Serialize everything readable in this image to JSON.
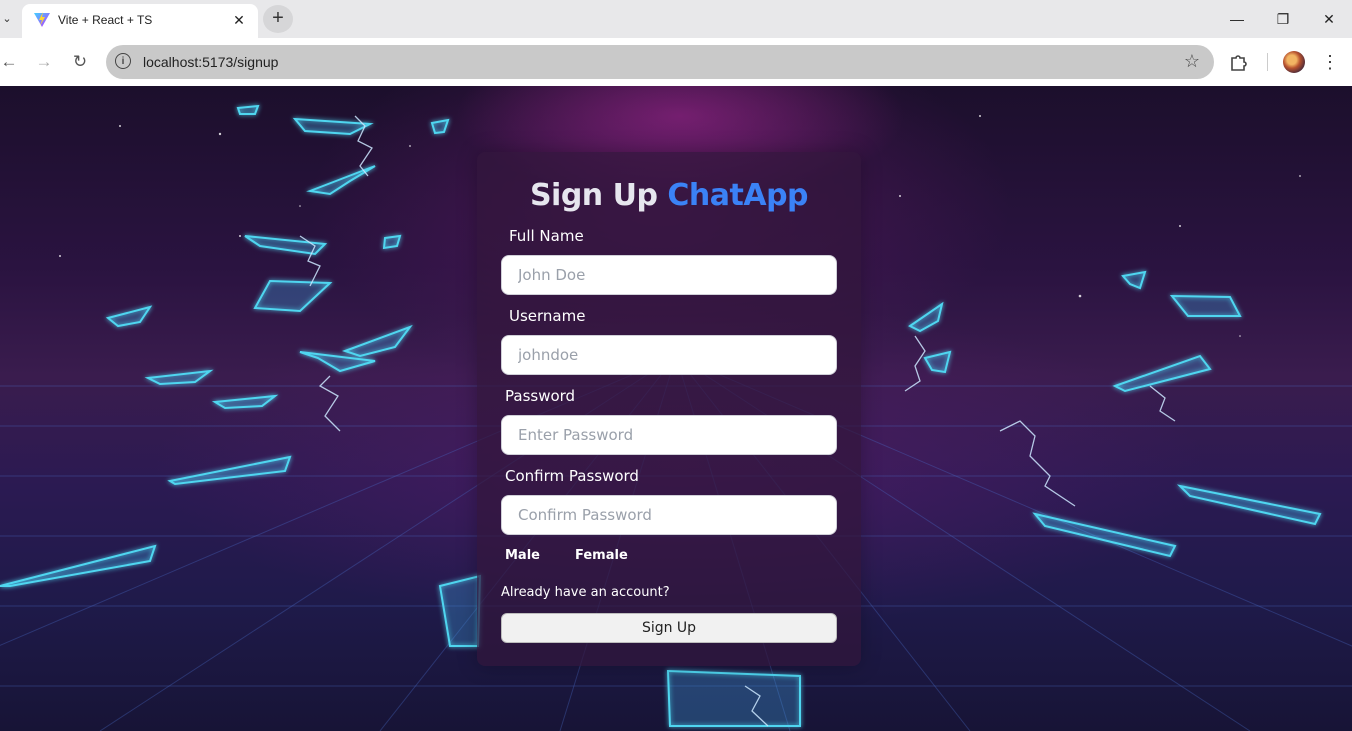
{
  "browser": {
    "tab_title": "Vite + React + TS",
    "url": "localhost:5173/signup",
    "icons": {
      "tab_list": "chevron-down-icon",
      "tab_close": "close-icon",
      "new_tab": "plus-icon",
      "minimize": "minimize-icon",
      "restore": "restore-icon",
      "close": "close-icon",
      "back": "arrow-left-icon",
      "forward": "arrow-right-icon",
      "reload": "reload-icon",
      "site_info": "info-icon",
      "bookmark": "star-icon",
      "extensions": "puzzle-icon",
      "menu": "kebab-menu-icon"
    },
    "glyphs": {
      "tab_list": "⌄",
      "tab_close": "✕",
      "new_tab": "+",
      "minimize": "—",
      "restore": "❐",
      "close": "✕",
      "back": "←",
      "forward": "→",
      "reload": "↻",
      "site_info": "i",
      "bookmark": "☆",
      "menu": "⋮"
    }
  },
  "signup": {
    "title": "Sign Up",
    "brand": "ChatApp",
    "full_name_label": "Full Name",
    "full_name_placeholder": "John Doe",
    "username_label": "Username",
    "username_placeholder": "johndoe",
    "password_label": "Password",
    "password_placeholder": "Enter Password",
    "confirm_label": "Confirm Password",
    "confirm_placeholder": "Confirm Password",
    "gender_options": [
      "Male",
      "Female"
    ],
    "login_link": "Already have an account?",
    "submit_label": "Sign Up"
  },
  "colors": {
    "brand": "#3b82f6",
    "neon": "#4fd6f0",
    "card_bg": "#32163c"
  }
}
